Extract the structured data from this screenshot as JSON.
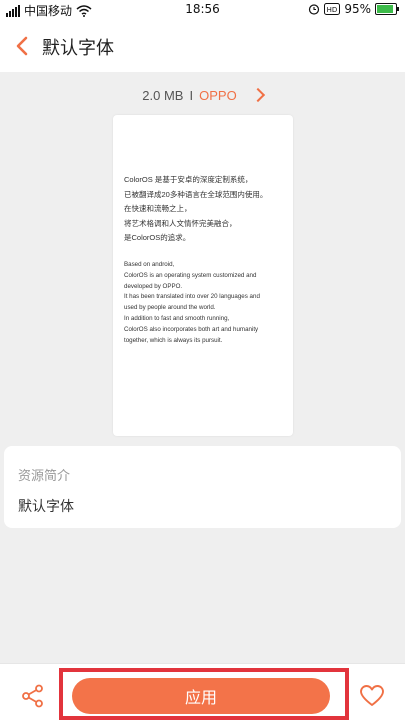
{
  "status_bar": {
    "carrier": "中国移动",
    "time": "18:56",
    "battery_percent": "95%"
  },
  "header": {
    "back_icon": "chevron-left-icon",
    "title": "默认字体"
  },
  "meta": {
    "size": "2.0 MB",
    "separator": "I",
    "author": "OPPO",
    "accent_color": "#f07045"
  },
  "preview": {
    "cn_lines": [
      "ColorOS 是基于安卓的深度定制系统，",
      "已被翻译成20多种语言在全球范围内使用。",
      "在快速和流畅之上，",
      "将艺术格调和人文情怀完美融合，",
      "是ColorOS的追求。"
    ],
    "en_lines": [
      "Based on android,",
      "ColorOS is an operating system customized and",
      "developed by OPPO.",
      "It has been translated into over 20 languages and",
      "used by people around the world.",
      "In addition to fast and smooth running,",
      "ColorOS also incorporates both art and humanity",
      "together, which is always its pursuit."
    ]
  },
  "intro": {
    "label": "资源简介",
    "value": "默认字体"
  },
  "bottom": {
    "apply_label": "应用",
    "share_icon": "share-icon",
    "favorite_icon": "heart-icon",
    "apply_color": "#f37349",
    "highlight_color": "#e2343c"
  }
}
